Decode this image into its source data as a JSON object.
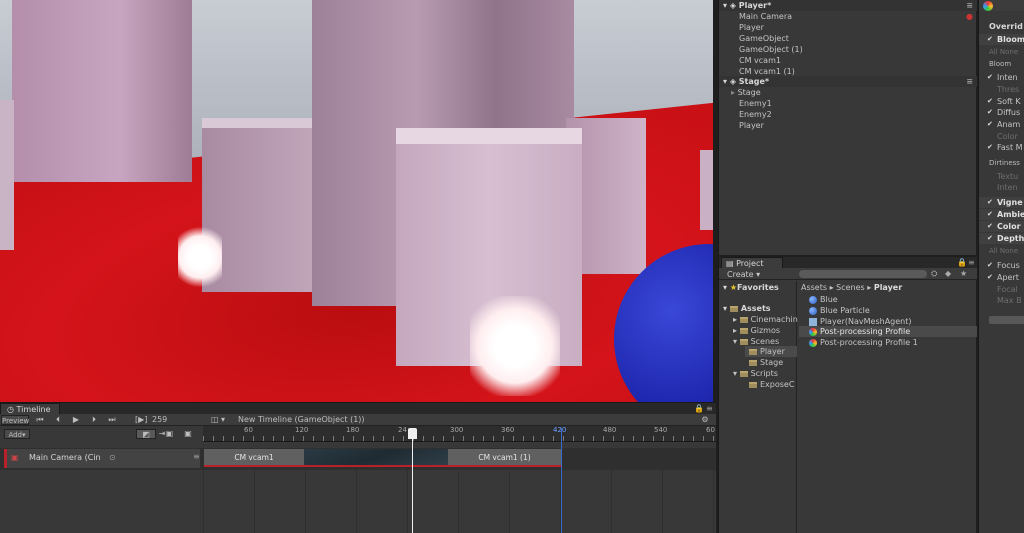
{
  "timeline": {
    "tab": "Timeline",
    "preview": "Preview",
    "add": "Add▾",
    "frame": "259",
    "asset": "New Timeline (GameObject (1))",
    "ticks": [
      "60",
      "120",
      "180",
      "24",
      "300",
      "360",
      "420",
      "480",
      "540",
      "60"
    ],
    "track_name": "Main Camera (Cin",
    "clip1": "CM vcam1",
    "clip2": "CM vcam1 (1)"
  },
  "hierarchy": {
    "player_scene": "Player*",
    "player_items": [
      "Main Camera",
      "Player",
      "GameObject",
      "GameObject (1)",
      "CM vcam1",
      "CM vcam1 (1)"
    ],
    "stage_scene": "Stage*",
    "stage_items": [
      "Stage",
      "Enemy1",
      "Enemy2",
      "Player"
    ]
  },
  "project": {
    "tab": "Project",
    "create": "Create ▾",
    "favorites": "Favorites",
    "assets": "Assets",
    "tree": [
      "Cinemachin",
      "Gizmos",
      "Scenes",
      "Player",
      "Stage",
      "Scripts",
      "ExposeC"
    ],
    "breadcrumb": [
      "Assets",
      "Scenes",
      "Player"
    ],
    "files": [
      "Blue",
      "Blue Particle",
      "Player(NavMeshAgent)",
      "Post-processing Profile",
      "Post-processing Profile 1"
    ]
  },
  "inspector": {
    "overrides": "Overrid",
    "bloom_hdr": "Bloom",
    "all_none": "All  None",
    "bloom_label": "Bloom",
    "bloom_rows": [
      "Inten",
      "Thres",
      "Soft K",
      "Diffus",
      "Anam",
      "Color",
      "Fast M"
    ],
    "dirtiness": "Dirtiness",
    "dirt_rows": [
      "Textu",
      "Inten"
    ],
    "effects": [
      "Vigne",
      "Ambie",
      "Color",
      "Depth"
    ],
    "all_none2": "All  None",
    "dof_rows": [
      "Focus",
      "Apert",
      "Focal",
      "Max B"
    ]
  }
}
